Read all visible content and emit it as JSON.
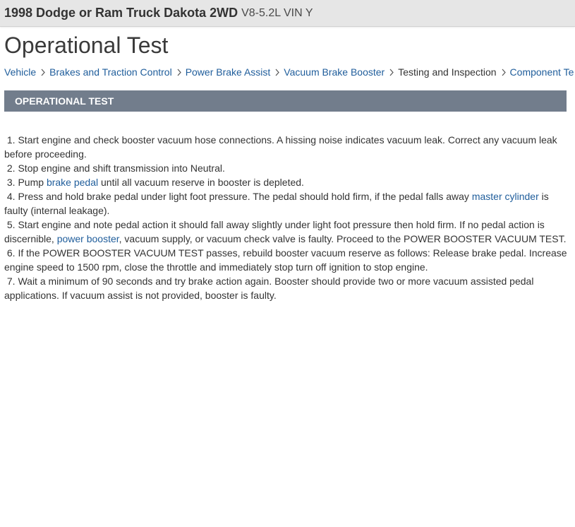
{
  "header": {
    "vehicle_title": "1998 Dodge or Ram Truck Dakota 2WD",
    "engine": "V8-5.2L VIN Y"
  },
  "page": {
    "title": "Operational Test"
  },
  "breadcrumb": {
    "items": [
      {
        "label": "Vehicle",
        "link": true
      },
      {
        "label": "Brakes and Traction Control",
        "link": true
      },
      {
        "label": "Power Brake Assist",
        "link": true
      },
      {
        "label": "Vacuum Brake Booster",
        "link": true
      },
      {
        "label": "Testing and Inspection",
        "link": false
      },
      {
        "label": "Component Te",
        "link": true
      }
    ]
  },
  "section": {
    "header": "OPERATIONAL TEST"
  },
  "steps": [
    {
      "num": " 1. ",
      "pre": "Start engine and check booster vacuum hose connections. A hissing noise indicates vacuum leak. Correct any vacuum leak before proceeding.",
      "link": "",
      "post": ""
    },
    {
      "num": " 2. ",
      "pre": "Stop engine and shift transmission into Neutral.",
      "link": "",
      "post": ""
    },
    {
      "num": " 3. ",
      "pre": "Pump ",
      "link": "brake pedal",
      "post": " until all vacuum reserve in booster is depleted."
    },
    {
      "num": " 4. ",
      "pre": "Press and hold brake pedal under light foot pressure. The pedal should hold firm, if the pedal falls away ",
      "link": "master cylinder",
      "post": " is faulty (internal leakage)."
    },
    {
      "num": " 5. ",
      "pre": "Start engine and note pedal action it should fall away slightly under light foot pressure then hold firm. If no pedal action is discernible, ",
      "link": "power booster",
      "post": ", vacuum supply, or vacuum check valve is faulty. Proceed to the POWER BOOSTER VACUUM TEST."
    },
    {
      "num": " 6. ",
      "pre": "If the POWER BOOSTER VACUUM TEST passes, rebuild booster vacuum reserve as follows: Release brake pedal. Increase engine speed to 1500 rpm, close the throttle and immediately stop turn off ignition to stop engine.",
      "link": "",
      "post": ""
    },
    {
      "num": " 7. ",
      "pre": "Wait a minimum of 90 seconds and try brake action again. Booster should provide two or more vacuum assisted pedal applications. If vacuum assist is not provided, booster is faulty.",
      "link": "",
      "post": ""
    }
  ],
  "icons": {
    "breadcrumb_separator": "chevron-right-icon"
  },
  "colors": {
    "link": "#1f5d9b",
    "section_header_bg": "#727d8c",
    "topbar_bg": "#e6e6e6"
  }
}
